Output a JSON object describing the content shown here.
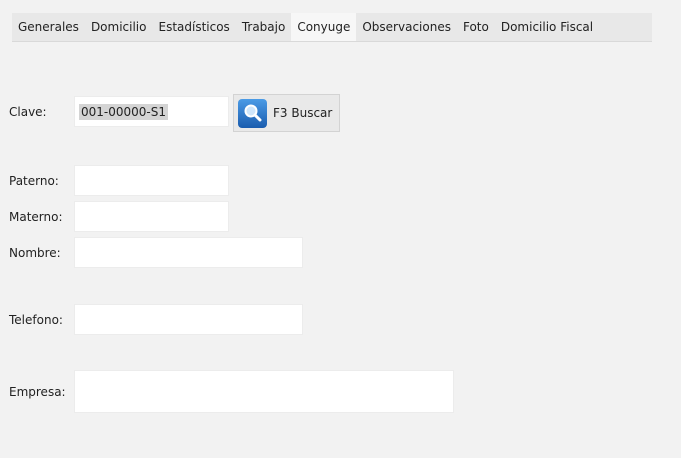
{
  "tabs": [
    {
      "label": "Generales",
      "active": false
    },
    {
      "label": "Domicilio",
      "active": false
    },
    {
      "label": "Estadísticos",
      "active": false
    },
    {
      "label": "Trabajo",
      "active": false
    },
    {
      "label": "Conyuge",
      "active": true
    },
    {
      "label": "Observaciones",
      "active": false
    },
    {
      "label": "Foto",
      "active": false
    },
    {
      "label": "Domicilio Fiscal",
      "active": false
    }
  ],
  "form": {
    "clave_label": "Clave:",
    "clave_value": "001-00000-S1",
    "search_button": "F3 Buscar",
    "paterno_label": "Paterno:",
    "paterno_value": "",
    "materno_label": "Materno:",
    "materno_value": "",
    "nombre_label": "Nombre:",
    "nombre_value": "",
    "telefono_label": "Telefono:",
    "telefono_value": "",
    "empresa_label": "Empresa:",
    "empresa_value": ""
  },
  "icons": {
    "search_button_icon": "magnifier-icon"
  },
  "colors": {
    "background": "#f2f2f2",
    "icon_blue": "#2b74c9"
  }
}
